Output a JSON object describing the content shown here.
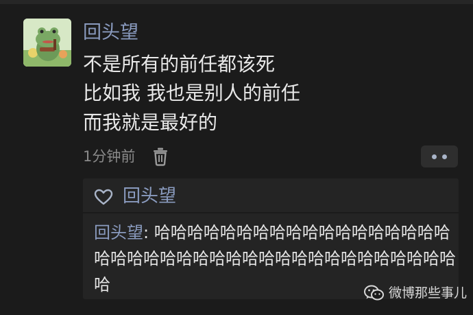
{
  "comment": {
    "username": "回头望",
    "lines": [
      "不是所有的前任都该死",
      "比如我 我也是别人的前任",
      "而我就是最好的"
    ],
    "time": "1分钟前"
  },
  "reply": {
    "liked_by": "回头望",
    "author": "回头望",
    "separator": ": ",
    "text": "哈哈哈哈哈哈哈哈哈哈哈哈哈哈哈哈哈哈哈哈哈哈哈哈哈哈哈哈哈哈哈哈哈哈哈哈哈哈哈哈哈"
  },
  "watermark": {
    "text": "微博那些事儿"
  },
  "icons": {
    "delete": "trash-icon",
    "more": "more-dots-icon",
    "like": "heart-icon",
    "source": "wechat-icon"
  },
  "colors": {
    "background": "#1b1b1b",
    "username": "#8a9bbf",
    "body_text": "#e8e8e8",
    "meta_text": "#8a8a8a",
    "reply_box": "#242424"
  }
}
